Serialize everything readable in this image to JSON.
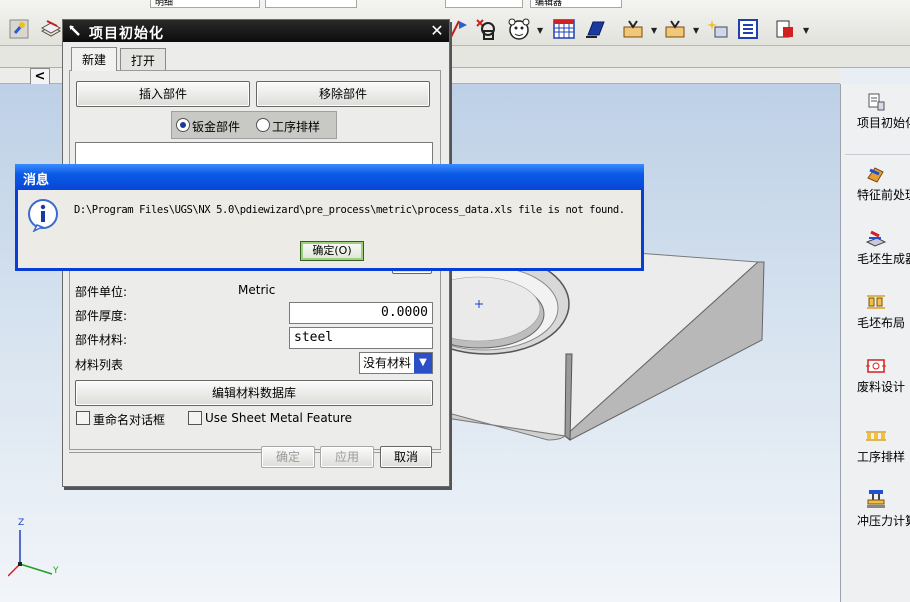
{
  "toolbar": {
    "strip_left": "明细",
    "strip_right": "编辑器"
  },
  "main_dialog": {
    "title": "项目初始化",
    "tabs": [
      {
        "label": "新建",
        "active": true
      },
      {
        "label": "打开",
        "active": false
      }
    ],
    "insert_part_button": "插入部件",
    "remove_part_button": "移除部件",
    "radio_options": [
      {
        "label": "钣金部件",
        "selected": true
      },
      {
        "label": "工序排样",
        "selected": false
      }
    ],
    "part_unit_label": "部件单位:",
    "part_unit_value": "Metric",
    "thickness_label": "部件厚度:",
    "thickness_value": "0.0000",
    "material_label": "部件材料:",
    "material_value": "steel",
    "material_list_label": "材料列表",
    "material_list_value": "没有材料",
    "edit_db_button": "编辑材料数据库",
    "rename_dialog_label": "重命名对话框",
    "rename_dialog_checked": false,
    "use_sheet_metal_label": "Use Sheet Metal Feature",
    "use_sheet_metal_checked": false,
    "ok_button": "确定",
    "apply_button": "应用",
    "cancel_button": "取消"
  },
  "message_box": {
    "title": "消息",
    "text": "D:\\Program Files\\UGS\\NX 5.0\\pdiewizard\\pre_process\\metric\\process_data.xls file is not found.",
    "ok_button": "确定(O)"
  },
  "resource_bar": {
    "items": [
      {
        "label": "项目初始化",
        "icon": "project-init-icon"
      },
      {
        "label": "特征前处理",
        "icon": "feature-preprocess-icon"
      },
      {
        "label": "毛坯生成器",
        "icon": "blank-generator-icon"
      },
      {
        "label": "毛坯布局",
        "icon": "blank-layout-icon"
      },
      {
        "label": "废料设计",
        "icon": "scrap-design-icon"
      },
      {
        "label": "工序排样",
        "icon": "process-layout-icon"
      },
      {
        "label": "冲压力计算",
        "icon": "press-force-icon"
      }
    ]
  },
  "axes": {
    "z": "Z",
    "y": "Y"
  },
  "colors": {
    "titlebar_dark": "#0c0c0c",
    "message_title_blue": "#0b5ae6",
    "viewport_top": "#bdd0e6",
    "select_arrow_blue": "#2a4fc6"
  }
}
